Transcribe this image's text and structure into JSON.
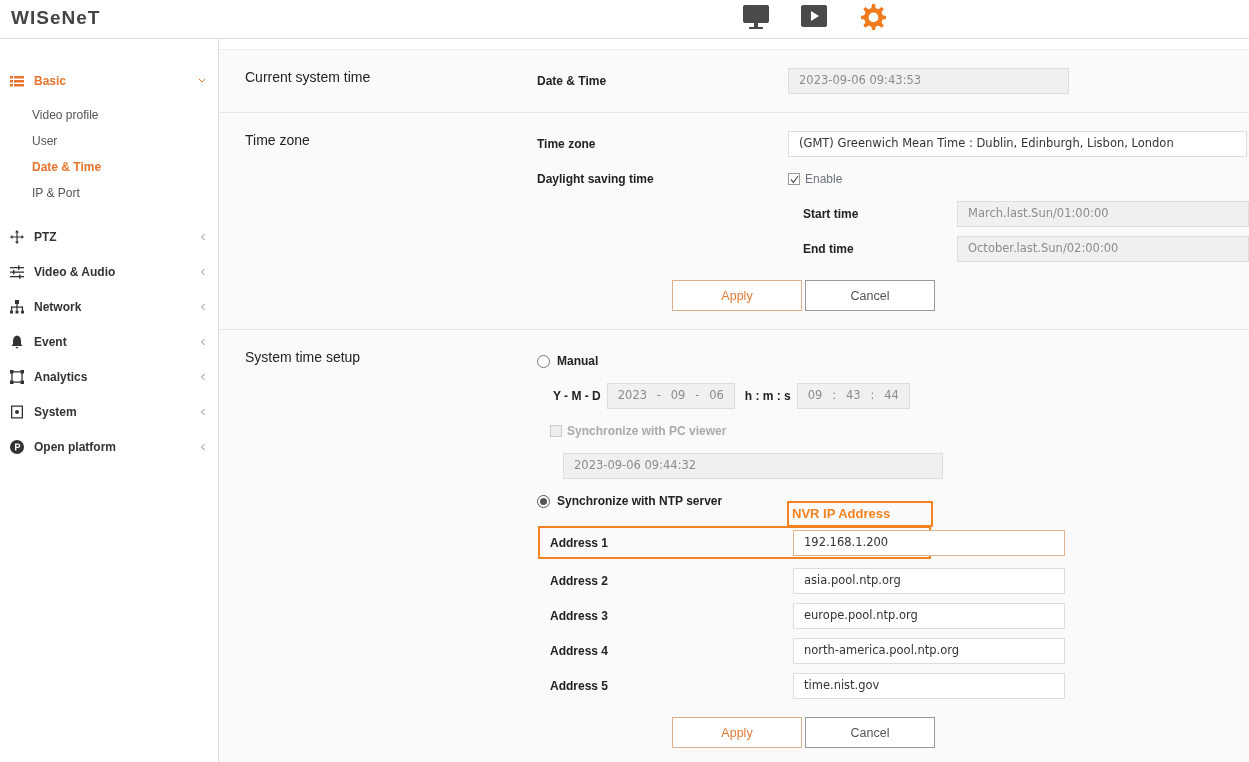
{
  "header": {
    "logo": "WISeNeT",
    "nav": [
      {
        "kind": "monitor",
        "selected": false
      },
      {
        "kind": "play",
        "selected": false
      },
      {
        "kind": "settings",
        "selected": true
      }
    ]
  },
  "sidebar": {
    "items": [
      {
        "label": "Basic",
        "kind": "list",
        "expanded": true,
        "selected": true,
        "children": [
          {
            "label": "Video profile",
            "selected": false
          },
          {
            "label": "User",
            "selected": false
          },
          {
            "label": "Date & Time",
            "selected": true
          },
          {
            "label": "IP & Port",
            "selected": false
          }
        ]
      },
      {
        "label": "PTZ",
        "kind": "move",
        "expanded": false,
        "selected": false
      },
      {
        "label": "Video & Audio",
        "kind": "sliders",
        "expanded": false,
        "selected": false
      },
      {
        "label": "Network",
        "kind": "network",
        "expanded": false,
        "selected": false
      },
      {
        "label": "Event",
        "kind": "bell",
        "expanded": false,
        "selected": false
      },
      {
        "label": "Analytics",
        "kind": "frame",
        "expanded": false,
        "selected": false
      },
      {
        "label": "System",
        "kind": "system",
        "expanded": false,
        "selected": false
      },
      {
        "label": "Open platform",
        "kind": "platform",
        "expanded": false,
        "selected": false
      }
    ]
  },
  "sections": [
    {
      "title": "Current system time",
      "rows": [
        {
          "kind": "field",
          "label": "Date & Time",
          "value": "2023-09-06 09:43:53",
          "disabled": true
        }
      ]
    },
    {
      "title": "Time zone",
      "rows": [
        {
          "kind": "select",
          "label": "Time zone",
          "value": "(GMT) Greenwich Mean Time : Dublin, Edinburgh, Lisbon, London"
        },
        {
          "kind": "checkbox",
          "label": "Daylight saving time",
          "option": "Enable",
          "checked": true
        },
        {
          "kind": "subfield",
          "label": "Start time",
          "value": "March.last.Sun/01:00:00",
          "disabled": true
        },
        {
          "kind": "subfield",
          "label": "End time",
          "value": "October.last.Sun/02:00:00",
          "disabled": true
        }
      ],
      "buttons": [
        {
          "label": "Apply",
          "kind": "primary"
        },
        {
          "label": "Cancel",
          "kind": "secondary"
        }
      ]
    },
    {
      "title": "System time setup",
      "rows": [
        {
          "kind": "radio",
          "label": "Manual",
          "selected": false
        },
        {
          "kind": "datetime",
          "date_label": "Y - M - D",
          "date": [
            "2023",
            "09",
            "06"
          ],
          "date_separator": "-",
          "time_label": "h : m : s",
          "time": [
            "09",
            "43",
            "44"
          ],
          "time_separator": ":",
          "disabled": true
        },
        {
          "kind": "subcheckbox",
          "label": "Synchronize with PC viewer",
          "checked": false,
          "disabled": true
        },
        {
          "kind": "pcfield",
          "value": "2023-09-06 09:44:32",
          "disabled": true
        },
        {
          "kind": "radio",
          "label": "Synchronize with NTP server",
          "selected": true
        },
        {
          "kind": "address",
          "label": "Address 1",
          "value": "192.168.1.200",
          "focused": true,
          "note": "NVR IP Address"
        },
        {
          "kind": "address",
          "label": "Address 2",
          "value": "asia.pool.ntp.org",
          "focused": false
        },
        {
          "kind": "address",
          "label": "Address 3",
          "value": "europe.pool.ntp.org",
          "focused": false
        },
        {
          "kind": "address",
          "label": "Address 4",
          "value": "north-america.pool.ntp.org",
          "focused": false
        },
        {
          "kind": "address",
          "label": "Address 5",
          "value": "time.nist.gov",
          "focused": false
        }
      ],
      "buttons": [
        {
          "label": "Apply",
          "kind": "primary"
        },
        {
          "label": "Cancel",
          "kind": "secondary"
        }
      ]
    }
  ]
}
